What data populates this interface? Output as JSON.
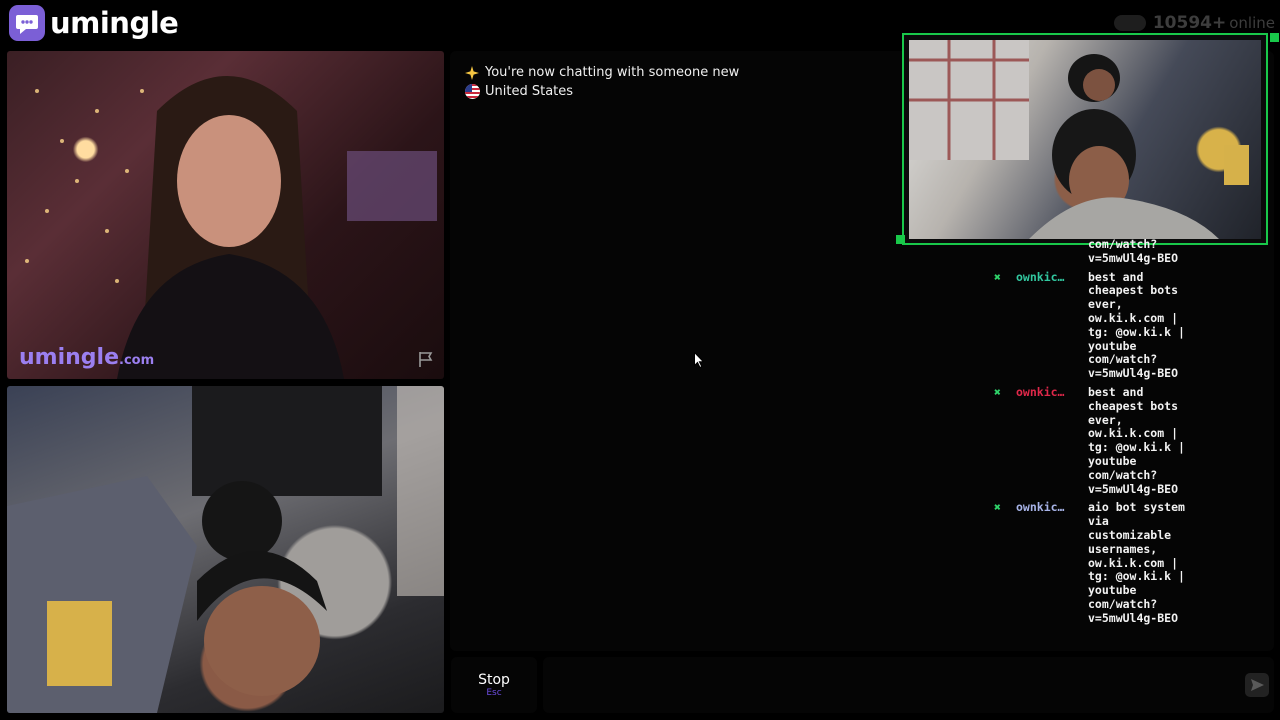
{
  "header": {
    "brand": "umingle",
    "online_count": "10594+",
    "online_label": "online"
  },
  "video": {
    "watermark_brand": "umingle",
    "watermark_tld": ".com"
  },
  "chat": {
    "status_icon": "sparkle-icon",
    "status_text": "You're now chatting with someone new",
    "country_flag": "us-flag-icon",
    "country": "United States",
    "messages": [
      {
        "icon": "x-icon",
        "name": "",
        "text": "com/watch?\nv=5mwUl4g-BEO",
        "name_color": "#32c8a0"
      },
      {
        "icon": "x-icon",
        "name": "ownkic…",
        "text": "best and\ncheapest bots\never,\now.ki.k.com |\ntg: @ow.ki.k |\nyoutube\ncom/watch?\nv=5mwUl4g-BEO",
        "name_color": "#32c8a0"
      },
      {
        "icon": "x-icon",
        "name": "ownkic…",
        "text": "best and\ncheapest bots\never,\now.ki.k.com |\ntg: @ow.ki.k |\nyoutube\ncom/watch?\nv=5mwUl4g-BEO",
        "name_color": "#e0284a"
      },
      {
        "icon": "x-icon",
        "name": "ownkic…",
        "text": "aio bot system\nvia\ncustomizable\nusernames,\now.ki.k.com |\ntg: @ow.ki.k |\nyoutube\ncom/watch?\nv=5mwUl4g-BEO",
        "name_color": "#a8b4e8"
      }
    ]
  },
  "controls": {
    "stop_label": "Stop",
    "stop_key": "Esc",
    "input_placeholder": "",
    "input_value": ""
  },
  "colors": {
    "accent": "#7b5fd6",
    "float_border": "#19c84a"
  }
}
